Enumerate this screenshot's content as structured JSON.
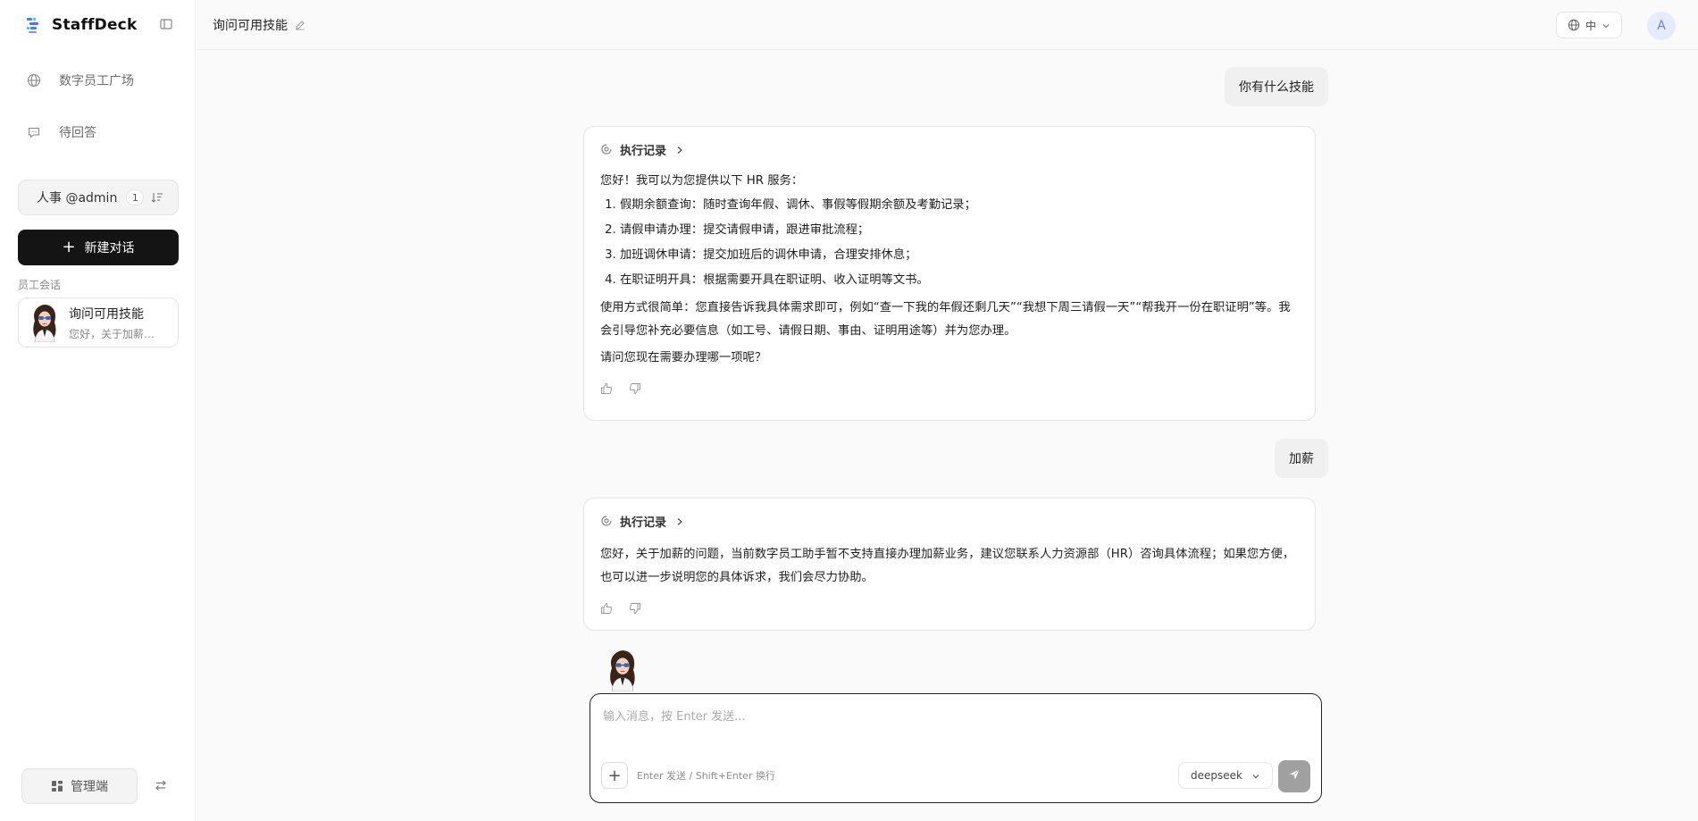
{
  "app": {
    "name": "StaffDeck"
  },
  "sidebar": {
    "nav": [
      {
        "label": "数字员工广场",
        "icon": "globe-icon"
      },
      {
        "label": "待回答",
        "icon": "chat-bubble-icon"
      }
    ],
    "workspace": {
      "label": "人事 @admin",
      "count": "1"
    },
    "new_chat_label": "新建对话",
    "section_label": "员工会话",
    "sessions": [
      {
        "title": "询问可用技能",
        "preview": "您好，关于加薪的问题，当前数字员工助手暂不支持直接办理加薪业务"
      }
    ],
    "admin_label": "管理端"
  },
  "header": {
    "chat_title": "询问可用技能",
    "lang": "中",
    "avatar_initial": "A"
  },
  "messages": {
    "user_1": "你有什么技能",
    "exec_label": "执行记录",
    "ai_1": {
      "intro": "您好！我可以为您提供以下 HR 服务：",
      "items": [
        "假期余额查询：随时查询年假、调休、事假等假期余额及考勤记录；",
        "请假申请办理：提交请假申请，跟进审批流程；",
        "加班调休申请：提交加班后的调休申请，合理安排休息；",
        "在职证明开具：根据需要开具在职证明、收入证明等文书。"
      ],
      "usage": "使用方式很简单：您直接告诉我具体需求即可，例如“查一下我的年假还剩几天”“我想下周三请假一天”“帮我开一份在职证明”等。我会引导您补充必要信息（如工号、请假日期、事由、证明用途等）并为您办理。",
      "question": "请问您现在需要办理哪一项呢？"
    },
    "user_2": "加薪",
    "ai_2": {
      "text": "您好，关于加薪的问题，当前数字员工助手暂不支持直接办理加薪业务，建议您联系人力资源部（HR）咨询具体流程；如果您方便，也可以进一步说明您的具体诉求，我们会尽力协助。"
    }
  },
  "composer": {
    "placeholder": "输入消息，按 Enter 发送...",
    "hint": "Enter 发送 / Shift+Enter 换行",
    "model": "deepseek"
  },
  "colors": {
    "primary_button": "#141414",
    "send_disabled": "#a0a0a0",
    "avatar_bg": "#e7ebff",
    "brand_blue": "#3b82f6",
    "brand_cyan": "#22d3ee"
  }
}
